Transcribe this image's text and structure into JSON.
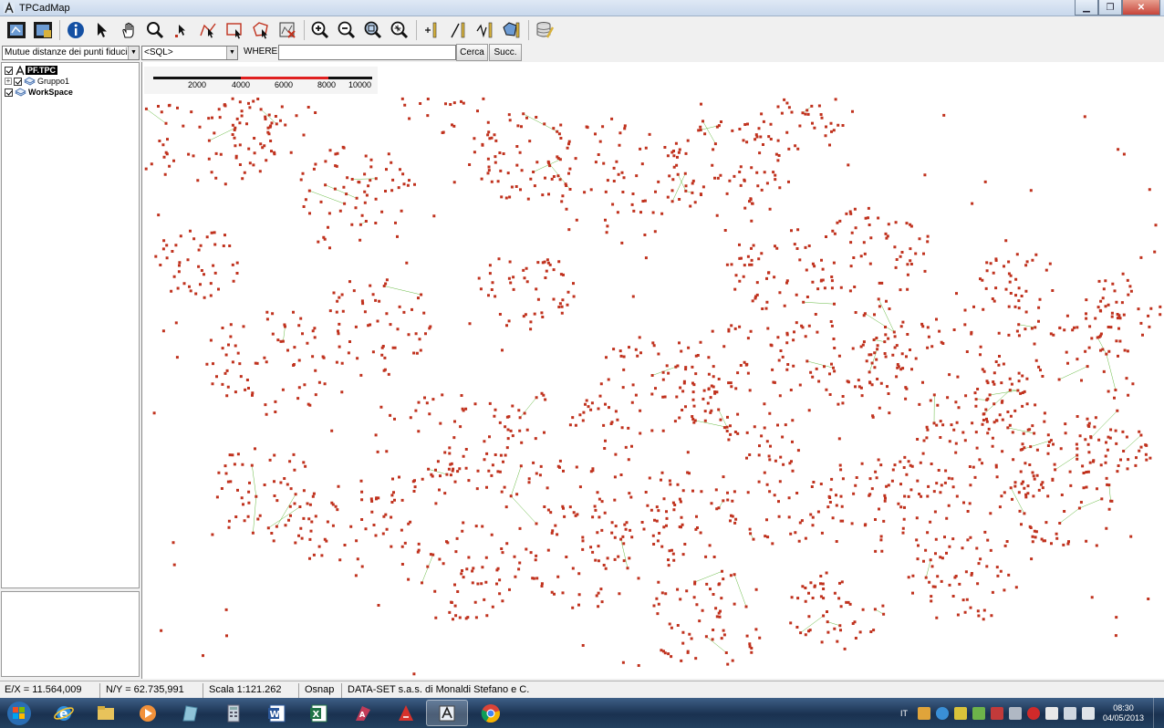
{
  "window": {
    "title": "TPCadMap"
  },
  "toolbar": {
    "tools": [
      "open-map-icon",
      "save-map-icon",
      "info-icon",
      "select-arrow-icon",
      "pan-hand-icon",
      "zoom-lens-icon",
      "point-select-icon",
      "polyline-select-icon",
      "rectangle-select-icon",
      "polygon-select-icon",
      "clear-selection-icon",
      "zoom-in-icon",
      "zoom-out-icon",
      "zoom-window-icon",
      "zoom-all-icon",
      "add-point-icon",
      "draw-line-icon",
      "draw-polyline-icon",
      "draw-polygon-icon",
      "database-icon"
    ]
  },
  "query": {
    "layer_select": "Mutue distanze dei punti fiduciali",
    "sql_select": "<SQL>",
    "where_label": "WHERE",
    "where_value": "",
    "search_label": "Cerca",
    "next_label": "Succ."
  },
  "tree": {
    "root": "PF.TPC",
    "group": "Gruppo1",
    "workspace": "WorkSpace"
  },
  "scalebar": {
    "ticks": [
      "2000",
      "4000",
      "6000",
      "8000",
      "10000"
    ]
  },
  "status": {
    "ex": "E/X = 11.564,009",
    "ny": "N/Y = 62.735,991",
    "scale": "Scala 1:121.262",
    "osnap": "Osnap",
    "company": "DATA-SET s.a.s. di Monaldi Stefano e C."
  },
  "taskbar": {
    "apps": [
      "windows-start-icon",
      "internet-explorer-icon",
      "file-explorer-icon",
      "media-player-icon",
      "notes-icon",
      "calculator-icon",
      "word-icon",
      "excel-icon",
      "access-icon",
      "autocad-icon",
      "tpcadmap-icon",
      "chrome-icon"
    ],
    "lang": "IT",
    "time": "08:30",
    "date": "04/05/2013"
  },
  "colors": {
    "network_lines": "#33a100",
    "points": "#c0321e",
    "map_bg": "#ffffff"
  }
}
